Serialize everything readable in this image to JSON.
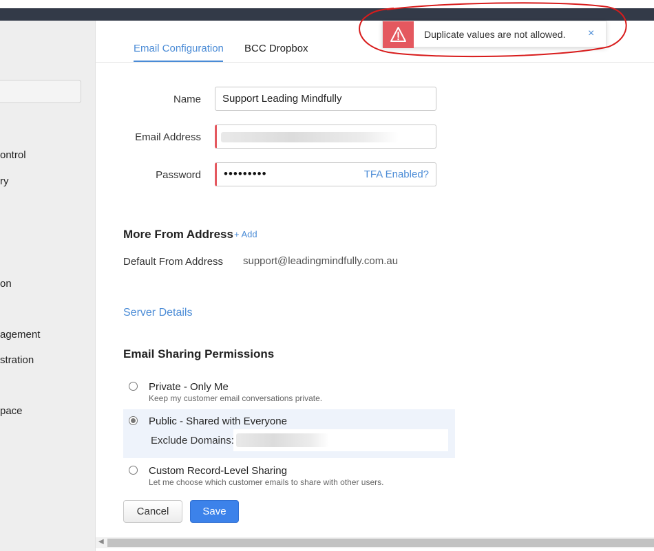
{
  "sidebar": {
    "items": [
      {
        "label": "ontrol"
      },
      {
        "label": "ry"
      },
      {
        "label": "on"
      },
      {
        "label": "agement"
      },
      {
        "label": "stration"
      },
      {
        "label": "pace"
      }
    ]
  },
  "tabs": [
    {
      "label": "Email Configuration"
    },
    {
      "label": "BCC Dropbox"
    }
  ],
  "form": {
    "name_label": "Name",
    "name_value": "Support Leading Mindfully",
    "email_label": "Email Address",
    "password_label": "Password",
    "password_dots": "•••••••••",
    "tfa_link": "TFA Enabled?"
  },
  "more_from": {
    "title": "More From Address",
    "add_link": "+ Add",
    "default_label": "Default From Address",
    "default_value": "support@leadingmindfully.com.au"
  },
  "server_details_link": "Server Details",
  "sharing": {
    "title": "Email Sharing Permissions",
    "options": [
      {
        "title": "Private - Only Me",
        "desc": "Keep my customer email conversations private.",
        "checked": false
      },
      {
        "title": "Public - Shared with Everyone",
        "checked": true
      },
      {
        "title": "Custom Record-Level Sharing",
        "desc": "Let me choose which customer emails to share with other users.",
        "checked": false
      }
    ],
    "exclude_label": "Exclude Domains:"
  },
  "buttons": {
    "cancel": "Cancel",
    "save": "Save"
  },
  "toast": {
    "message": "Duplicate values are not allowed.",
    "close": "×"
  },
  "colors": {
    "accent": "#4a8bd6",
    "error": "#e4585f",
    "save_button": "#3c82ea",
    "topbar": "#333a48",
    "annotation": "#d81c1c"
  }
}
